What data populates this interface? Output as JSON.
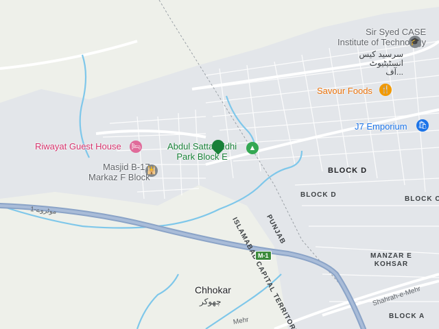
{
  "map": {
    "colors": {
      "land": "#eef0ea",
      "urban": "#e3e6ea",
      "motorway": "#8aa3c7",
      "road": "#ffffff",
      "water": "#7ec7ea",
      "border": "#9aa0a6"
    },
    "pois": {
      "riwayat": {
        "name": "Riwayat Guest House",
        "icon": "hotel-icon"
      },
      "masjid": {
        "name_line1": "Masjid B-17",
        "name_line2": "Markaz F Block",
        "icon": "mosque-icon"
      },
      "edhi_park": {
        "name_line1": "Abdul Sattar Edhi",
        "name_line2": "Park Block E",
        "icon": "park-icon"
      },
      "sir_syed": {
        "name_line1": "Sir Syed CASE",
        "name_line2": "Institute of Technology",
        "name_urdu": "سرسید کیس انسٹیٹیوٹ آف...",
        "icon": "school-icon"
      },
      "savour": {
        "name": "Savour Foods",
        "icon": "restaurant-icon"
      },
      "j7": {
        "name": "J7 Emporium",
        "icon": "shopping-icon"
      }
    },
    "areas": {
      "block_d_big": "BLOCK D",
      "block_d": "BLOCK D",
      "block_c": "BLOCK C",
      "block_a": "BLOCK A",
      "manzar_line1": "MANZAR E",
      "manzar_line2": "KOHSAR"
    },
    "border_label_line1": "ISLAMABAD CAPITAL TERRITORY",
    "border_label_line2": "PUNJAB",
    "town": {
      "name": "Chhokar",
      "name_urdu": "چھوکر"
    },
    "roads": {
      "motorway_shield": "M-1",
      "motorway_urdu": "1-موٹروے",
      "shahrah": "Shahrah-e-Mehr",
      "mehr": "Mehr"
    }
  }
}
